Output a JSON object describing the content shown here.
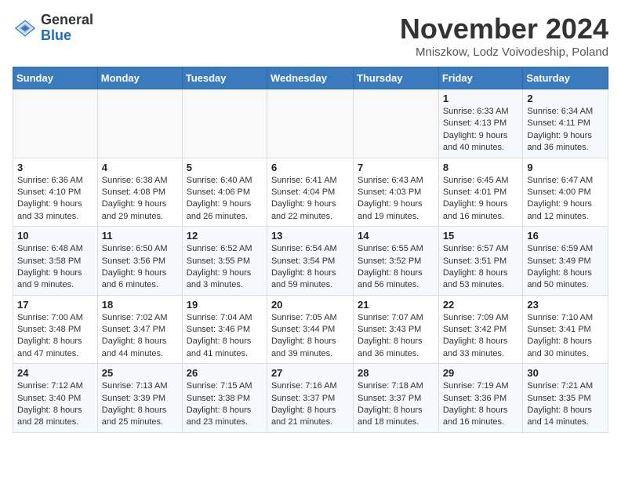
{
  "header": {
    "logo_general": "General",
    "logo_blue": "Blue",
    "month_title": "November 2024",
    "location": "Mniszkow, Lodz Voivodeship, Poland"
  },
  "days_of_week": [
    "Sunday",
    "Monday",
    "Tuesday",
    "Wednesday",
    "Thursday",
    "Friday",
    "Saturday"
  ],
  "weeks": [
    [
      {
        "day": "",
        "info": ""
      },
      {
        "day": "",
        "info": ""
      },
      {
        "day": "",
        "info": ""
      },
      {
        "day": "",
        "info": ""
      },
      {
        "day": "",
        "info": ""
      },
      {
        "day": "1",
        "info": "Sunrise: 6:33 AM\nSunset: 4:13 PM\nDaylight: 9 hours\nand 40 minutes."
      },
      {
        "day": "2",
        "info": "Sunrise: 6:34 AM\nSunset: 4:11 PM\nDaylight: 9 hours\nand 36 minutes."
      }
    ],
    [
      {
        "day": "3",
        "info": "Sunrise: 6:36 AM\nSunset: 4:10 PM\nDaylight: 9 hours\nand 33 minutes."
      },
      {
        "day": "4",
        "info": "Sunrise: 6:38 AM\nSunset: 4:08 PM\nDaylight: 9 hours\nand 29 minutes."
      },
      {
        "day": "5",
        "info": "Sunrise: 6:40 AM\nSunset: 4:06 PM\nDaylight: 9 hours\nand 26 minutes."
      },
      {
        "day": "6",
        "info": "Sunrise: 6:41 AM\nSunset: 4:04 PM\nDaylight: 9 hours\nand 22 minutes."
      },
      {
        "day": "7",
        "info": "Sunrise: 6:43 AM\nSunset: 4:03 PM\nDaylight: 9 hours\nand 19 minutes."
      },
      {
        "day": "8",
        "info": "Sunrise: 6:45 AM\nSunset: 4:01 PM\nDaylight: 9 hours\nand 16 minutes."
      },
      {
        "day": "9",
        "info": "Sunrise: 6:47 AM\nSunset: 4:00 PM\nDaylight: 9 hours\nand 12 minutes."
      }
    ],
    [
      {
        "day": "10",
        "info": "Sunrise: 6:48 AM\nSunset: 3:58 PM\nDaylight: 9 hours\nand 9 minutes."
      },
      {
        "day": "11",
        "info": "Sunrise: 6:50 AM\nSunset: 3:56 PM\nDaylight: 9 hours\nand 6 minutes."
      },
      {
        "day": "12",
        "info": "Sunrise: 6:52 AM\nSunset: 3:55 PM\nDaylight: 9 hours\nand 3 minutes."
      },
      {
        "day": "13",
        "info": "Sunrise: 6:54 AM\nSunset: 3:54 PM\nDaylight: 8 hours\nand 59 minutes."
      },
      {
        "day": "14",
        "info": "Sunrise: 6:55 AM\nSunset: 3:52 PM\nDaylight: 8 hours\nand 56 minutes."
      },
      {
        "day": "15",
        "info": "Sunrise: 6:57 AM\nSunset: 3:51 PM\nDaylight: 8 hours\nand 53 minutes."
      },
      {
        "day": "16",
        "info": "Sunrise: 6:59 AM\nSunset: 3:49 PM\nDaylight: 8 hours\nand 50 minutes."
      }
    ],
    [
      {
        "day": "17",
        "info": "Sunrise: 7:00 AM\nSunset: 3:48 PM\nDaylight: 8 hours\nand 47 minutes."
      },
      {
        "day": "18",
        "info": "Sunrise: 7:02 AM\nSunset: 3:47 PM\nDaylight: 8 hours\nand 44 minutes."
      },
      {
        "day": "19",
        "info": "Sunrise: 7:04 AM\nSunset: 3:46 PM\nDaylight: 8 hours\nand 41 minutes."
      },
      {
        "day": "20",
        "info": "Sunrise: 7:05 AM\nSunset: 3:44 PM\nDaylight: 8 hours\nand 39 minutes."
      },
      {
        "day": "21",
        "info": "Sunrise: 7:07 AM\nSunset: 3:43 PM\nDaylight: 8 hours\nand 36 minutes."
      },
      {
        "day": "22",
        "info": "Sunrise: 7:09 AM\nSunset: 3:42 PM\nDaylight: 8 hours\nand 33 minutes."
      },
      {
        "day": "23",
        "info": "Sunrise: 7:10 AM\nSunset: 3:41 PM\nDaylight: 8 hours\nand 30 minutes."
      }
    ],
    [
      {
        "day": "24",
        "info": "Sunrise: 7:12 AM\nSunset: 3:40 PM\nDaylight: 8 hours\nand 28 minutes."
      },
      {
        "day": "25",
        "info": "Sunrise: 7:13 AM\nSunset: 3:39 PM\nDaylight: 8 hours\nand 25 minutes."
      },
      {
        "day": "26",
        "info": "Sunrise: 7:15 AM\nSunset: 3:38 PM\nDaylight: 8 hours\nand 23 minutes."
      },
      {
        "day": "27",
        "info": "Sunrise: 7:16 AM\nSunset: 3:37 PM\nDaylight: 8 hours\nand 21 minutes."
      },
      {
        "day": "28",
        "info": "Sunrise: 7:18 AM\nSunset: 3:37 PM\nDaylight: 8 hours\nand 18 minutes."
      },
      {
        "day": "29",
        "info": "Sunrise: 7:19 AM\nSunset: 3:36 PM\nDaylight: 8 hours\nand 16 minutes."
      },
      {
        "day": "30",
        "info": "Sunrise: 7:21 AM\nSunset: 3:35 PM\nDaylight: 8 hours\nand 14 minutes."
      }
    ]
  ]
}
